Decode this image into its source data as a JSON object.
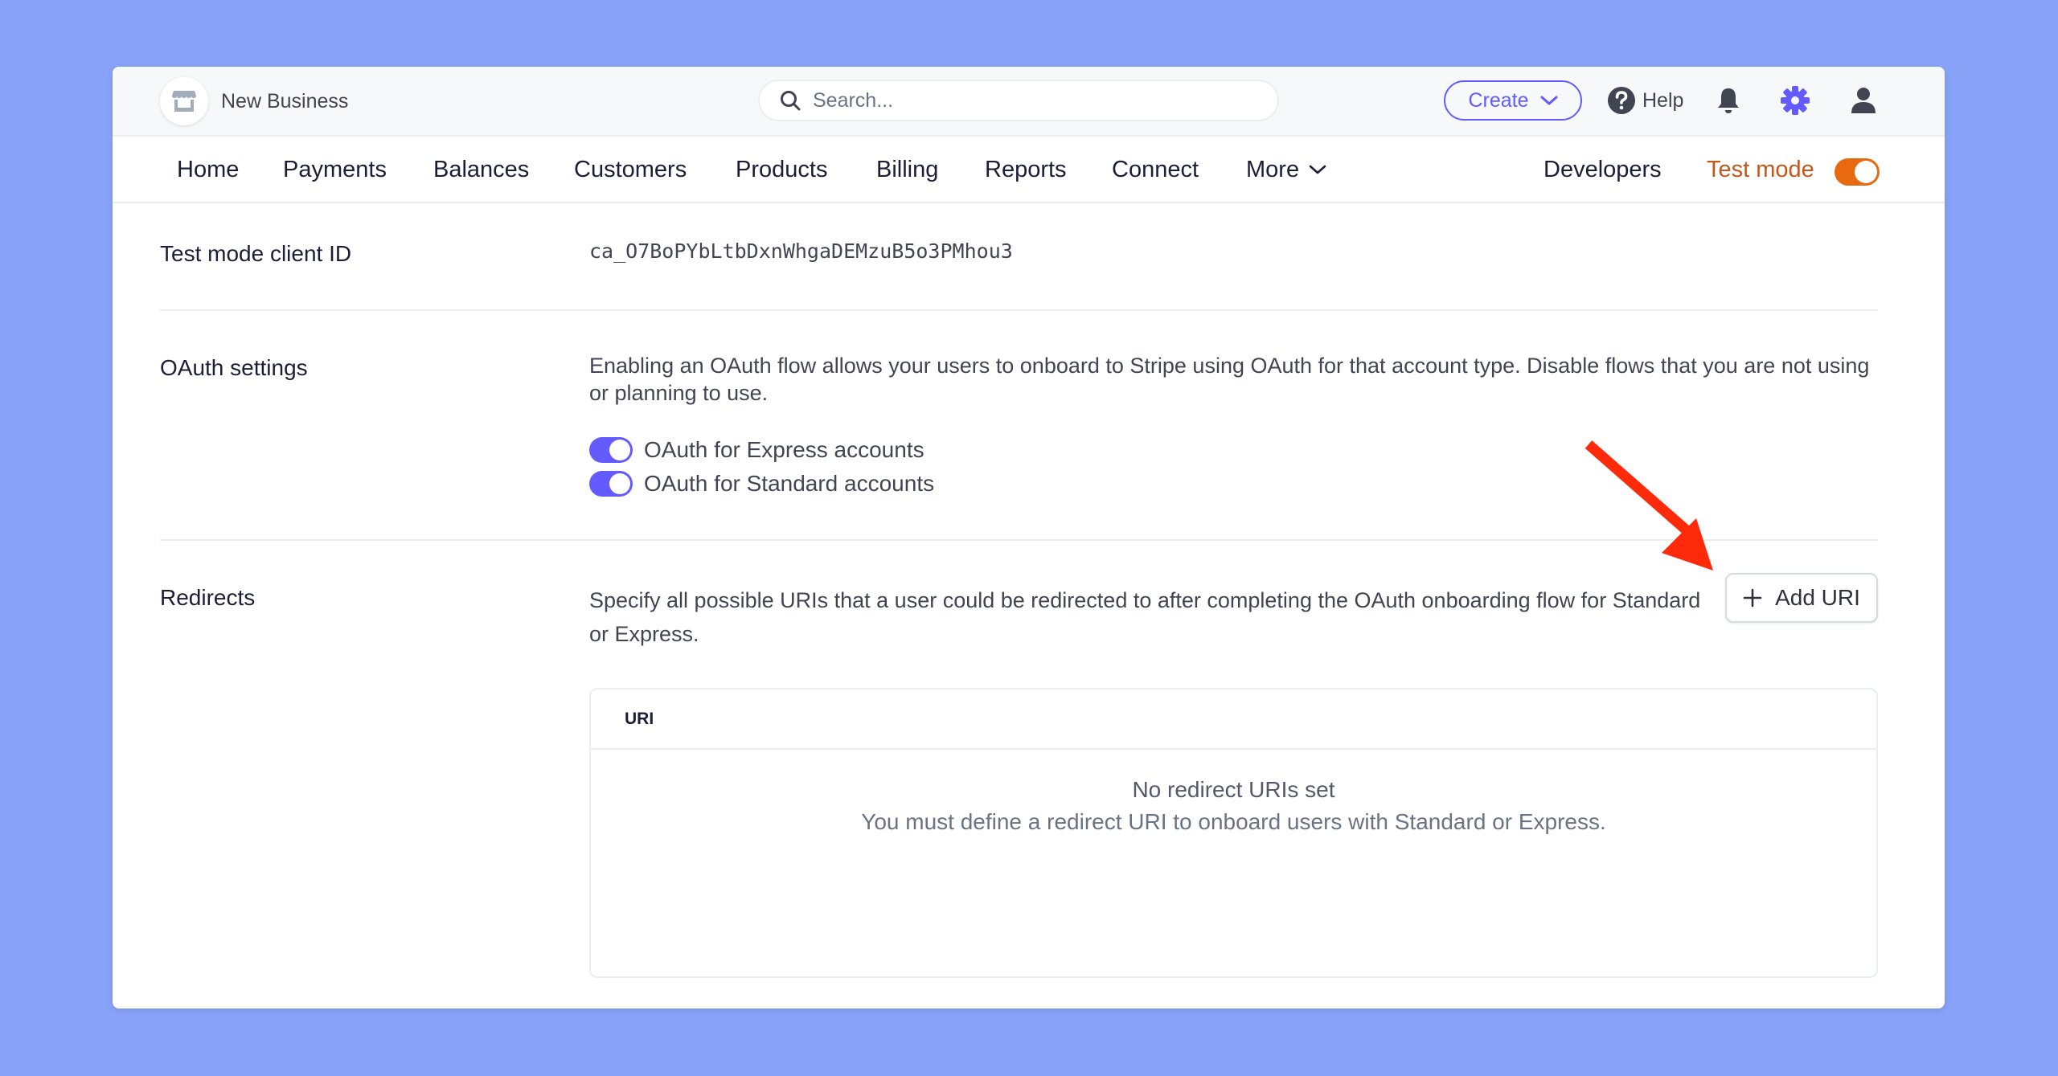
{
  "header": {
    "business_name": "New Business",
    "search_placeholder": "Search...",
    "create_label": "Create",
    "help_label": "Help"
  },
  "nav": {
    "items": [
      "Home",
      "Payments",
      "Balances",
      "Customers",
      "Products",
      "Billing",
      "Reports",
      "Connect"
    ],
    "more_label": "More",
    "developers_label": "Developers",
    "test_mode_label": "Test mode",
    "test_mode_on": true
  },
  "colors": {
    "background": "#87A2F7",
    "accent": "#635BFF",
    "test_mode": "#E8690F",
    "annotation_arrow": "#FF2A0A"
  },
  "client_id": {
    "label": "Test mode client ID",
    "value": "ca_O7BoPYbLtbDxnWhgaDEMzuB5o3PMhou3"
  },
  "oauth": {
    "label": "OAuth settings",
    "description": "Enabling an OAuth flow allows your users to onboard to Stripe using OAuth for that account type. Disable flows that you are not using or planning to use.",
    "toggles": [
      {
        "label": "OAuth for Express accounts",
        "enabled": true
      },
      {
        "label": "OAuth for Standard accounts",
        "enabled": true
      }
    ]
  },
  "redirects": {
    "label": "Redirects",
    "description": "Specify all possible URIs that a user could be redirected to after completing the OAuth onboarding flow for Standard or Express.",
    "add_button_label": "Add URI",
    "table": {
      "columns": [
        "URI"
      ],
      "rows": [],
      "empty_title": "No redirect URIs set",
      "empty_subtitle": "You must define a redirect URI to onboard users with Standard or Express."
    }
  }
}
